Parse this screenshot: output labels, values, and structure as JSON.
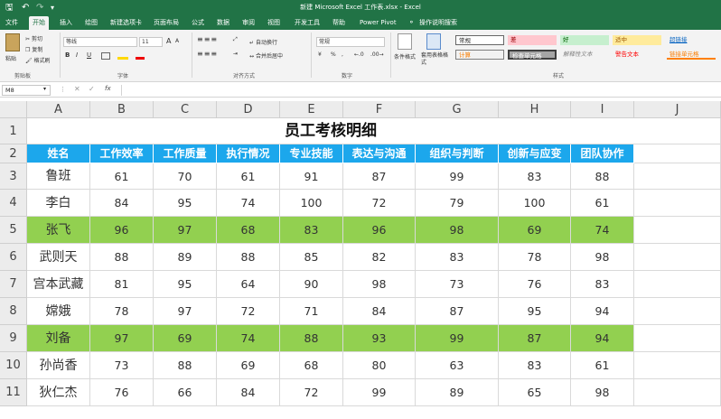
{
  "window": {
    "title": "新建 Microsoft Excel 工作表.xlsx - Excel",
    "save_icon": "save-icon",
    "undo_icon": "undo-icon",
    "redo_icon": "redo-icon"
  },
  "tabs": [
    "文件",
    "开始",
    "插入",
    "绘图",
    "新建选项卡",
    "页面布局",
    "公式",
    "数据",
    "审阅",
    "视图",
    "开发工具",
    "帮助",
    "Power Pivot",
    "操作说明搜索"
  ],
  "active_tab": "开始",
  "ribbon": {
    "clipboard": {
      "paste": "粘贴",
      "cut": "剪切",
      "copy": "复制",
      "format_painter": "格式刷",
      "label": "剪贴板"
    },
    "font": {
      "name": "等线",
      "size": "11",
      "label": "字体",
      "bold": "B",
      "italic": "I",
      "underline": "U",
      "grow": "A",
      "shrink": "A"
    },
    "alignment": {
      "wrap": "自动换行",
      "merge": "合并后居中",
      "label": "对齐方式"
    },
    "number": {
      "format": "常规",
      "label": "数字",
      "percent": "%",
      "comma": ","
    },
    "styles": {
      "conditional": "条件格式",
      "table": "套用表格格式",
      "label": "样式",
      "cells": [
        "常规",
        "差",
        "好",
        "适中",
        "超链接",
        "计算",
        "检查单元格",
        "解释性文本",
        "警告文本",
        "链接单元格"
      ]
    }
  },
  "formula_bar": {
    "name_box": "M8",
    "fx": "fx",
    "value": ""
  },
  "columns": [
    "A",
    "B",
    "C",
    "D",
    "E",
    "F",
    "G",
    "H",
    "I",
    "J"
  ],
  "rows": [
    "1",
    "2",
    "3",
    "4",
    "5",
    "6",
    "7",
    "8",
    "9",
    "10",
    "11"
  ],
  "sheet": {
    "title": "员工考核明细",
    "headers": [
      "姓名",
      "工作效率",
      "工作质量",
      "执行情况",
      "专业技能",
      "表达与沟通",
      "组织与判断",
      "创新与应变",
      "团队协作"
    ],
    "data": [
      [
        "鲁班",
        "61",
        "70",
        "61",
        "91",
        "87",
        "99",
        "83",
        "88"
      ],
      [
        "李白",
        "84",
        "95",
        "74",
        "100",
        "72",
        "79",
        "100",
        "61"
      ],
      [
        "张飞",
        "96",
        "97",
        "68",
        "83",
        "96",
        "98",
        "69",
        "74"
      ],
      [
        "武则天",
        "88",
        "89",
        "88",
        "85",
        "82",
        "83",
        "78",
        "98"
      ],
      [
        "宫本武藏",
        "81",
        "95",
        "64",
        "90",
        "98",
        "73",
        "76",
        "83"
      ],
      [
        "嫦娥",
        "78",
        "97",
        "72",
        "71",
        "84",
        "87",
        "95",
        "94"
      ],
      [
        "刘备",
        "97",
        "69",
        "74",
        "88",
        "93",
        "99",
        "87",
        "94"
      ],
      [
        "孙尚香",
        "73",
        "88",
        "69",
        "68",
        "80",
        "63",
        "83",
        "61"
      ],
      [
        "狄仁杰",
        "76",
        "66",
        "84",
        "72",
        "99",
        "89",
        "65",
        "98"
      ]
    ],
    "highlighted_rows": [
      2,
      6
    ],
    "colors": {
      "header_bg": "#1ca7ec",
      "highlight_bg": "#92d050",
      "excel_green": "#217346"
    }
  }
}
